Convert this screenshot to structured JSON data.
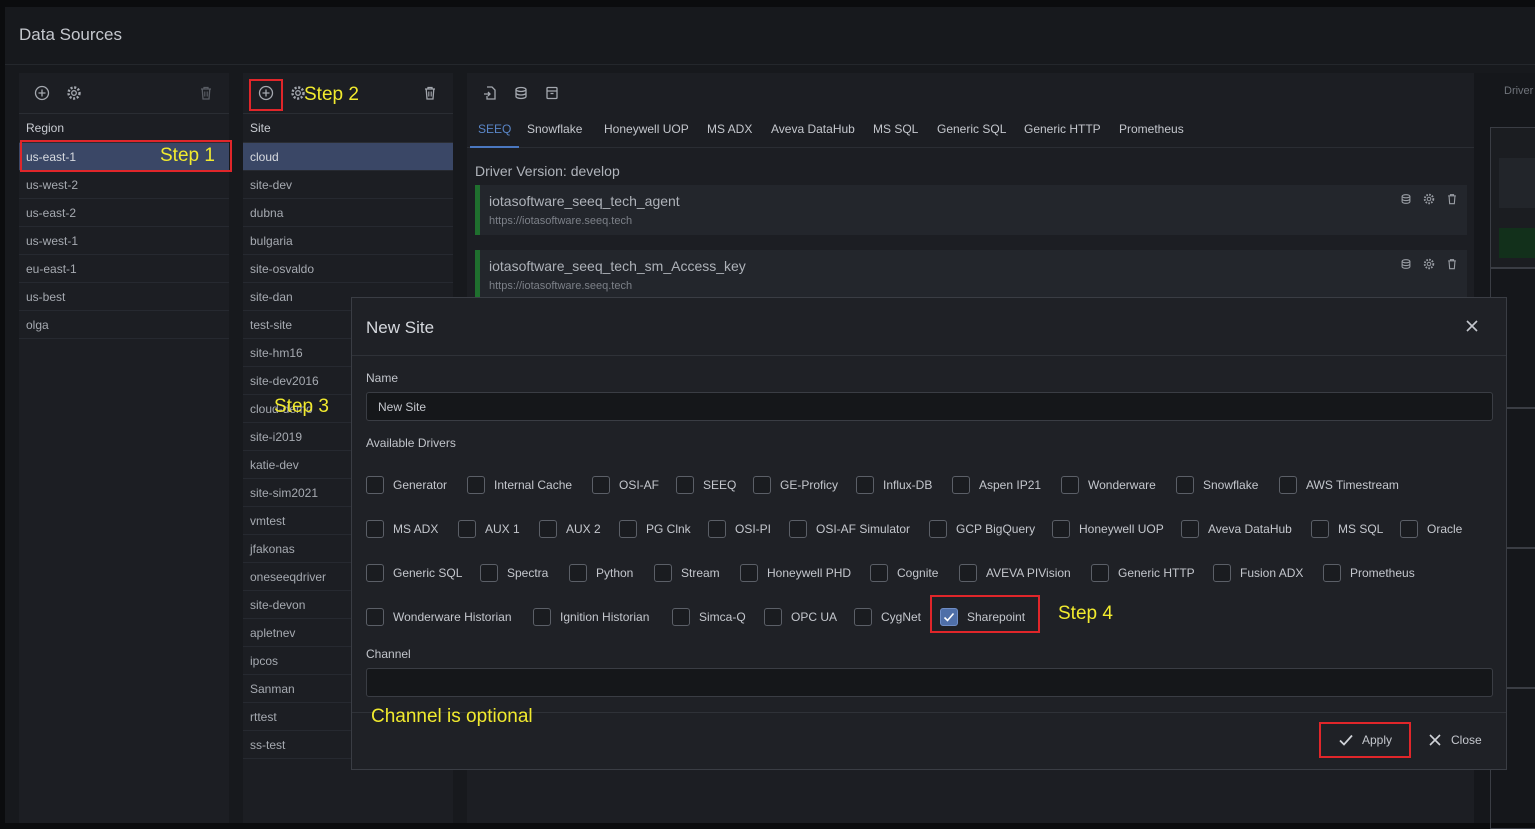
{
  "window": {
    "title": "Data Sources"
  },
  "regions": {
    "header": "Region",
    "items": [
      "us-east-1",
      "us-west-2",
      "us-east-2",
      "us-west-1",
      "eu-east-1",
      "us-best",
      "olga"
    ]
  },
  "sites": {
    "header": "Site",
    "items": [
      "cloud",
      "site-dev",
      "dubna",
      "bulgaria",
      "site-osvaldo",
      "site-dan",
      "test-site",
      "site-hm16",
      "site-dev2016",
      "cloud-demo",
      "site-i2019",
      "katie-dev",
      "site-sim2021",
      "vmtest",
      "jfakonas",
      "oneseeqdriver",
      "site-devon",
      "apletnev",
      "ipcos",
      "Sanman",
      "rttest",
      "ss-test"
    ]
  },
  "drivers_panel": {
    "tabs": [
      "SEEQ",
      "Snowflake",
      "Honeywell UOP",
      "MS ADX",
      "Aveva DataHub",
      "MS SQL",
      "Generic SQL",
      "Generic HTTP",
      "Prometheus"
    ],
    "active_tab": "SEEQ",
    "driver_version": "Driver Version: develop",
    "agents": [
      {
        "name": "iotasoftware_seeq_tech_agent",
        "url": "https://iotasoftware.seeq.tech"
      },
      {
        "name": "iotasoftware_seeq_tech_sm_Access_key",
        "url": "https://iotasoftware.seeq.tech"
      }
    ],
    "accent_color": "#4a77c0"
  },
  "right_panel": {
    "header": "Driver"
  },
  "modal": {
    "title": "New Site",
    "name_label": "Name",
    "name_value": "New Site",
    "drivers_label": "Available Drivers",
    "drivers": [
      [
        {
          "label": "Generator",
          "checked": false
        },
        {
          "label": "Internal Cache",
          "checked": false
        },
        {
          "label": "OSI-AF",
          "checked": false
        },
        {
          "label": "SEEQ",
          "checked": false
        },
        {
          "label": "GE-Proficy",
          "checked": false
        },
        {
          "label": "Influx-DB",
          "checked": false
        },
        {
          "label": "Aspen IP21",
          "checked": false
        },
        {
          "label": "Wonderware",
          "checked": false
        },
        {
          "label": "Snowflake",
          "checked": false
        },
        {
          "label": "AWS Timestream",
          "checked": false
        }
      ],
      [
        {
          "label": "MS ADX",
          "checked": false
        },
        {
          "label": "AUX 1",
          "checked": false
        },
        {
          "label": "AUX 2",
          "checked": false
        },
        {
          "label": "PG Clnk",
          "checked": false
        },
        {
          "label": "OSI-PI",
          "checked": false
        },
        {
          "label": "OSI-AF Simulator",
          "checked": false
        },
        {
          "label": "GCP BigQuery",
          "checked": false
        },
        {
          "label": "Honeywell UOP",
          "checked": false
        },
        {
          "label": "Aveva DataHub",
          "checked": false
        },
        {
          "label": "MS SQL",
          "checked": false
        },
        {
          "label": "Oracle",
          "checked": false
        }
      ],
      [
        {
          "label": "Generic SQL",
          "checked": false
        },
        {
          "label": "Spectra",
          "checked": false
        },
        {
          "label": "Python",
          "checked": false
        },
        {
          "label": "Stream",
          "checked": false
        },
        {
          "label": "Honeywell PHD",
          "checked": false
        },
        {
          "label": "Cognite",
          "checked": false
        },
        {
          "label": "AVEVA PIVision",
          "checked": false
        },
        {
          "label": "Generic HTTP",
          "checked": false
        },
        {
          "label": "Fusion ADX",
          "checked": false
        },
        {
          "label": "Prometheus",
          "checked": false
        }
      ],
      [
        {
          "label": "Wonderware Historian",
          "checked": false
        },
        {
          "label": "Ignition Historian",
          "checked": false
        },
        {
          "label": "Simca-Q",
          "checked": false
        },
        {
          "label": "OPC UA",
          "checked": false
        },
        {
          "label": "CygNet",
          "checked": false
        },
        {
          "label": "Sharepoint",
          "checked": true
        }
      ]
    ],
    "channel_label": "Channel",
    "channel_value": "",
    "apply_label": "Apply",
    "close_label": "Close"
  },
  "annotations": {
    "step1": "Step 1",
    "step2": "Step 2",
    "step3": "Step 3",
    "step4": "Step 4",
    "channel_note": "Channel is optional",
    "color": "#f1ea2e",
    "box_color": "#e0262a"
  },
  "icons": {
    "add": "plus-circle-icon",
    "settings": "gear-icon",
    "delete": "trash-icon",
    "import": "file-import-icon",
    "database": "database-icon",
    "archive": "archive-icon",
    "close": "close-icon",
    "check": "check-icon"
  }
}
